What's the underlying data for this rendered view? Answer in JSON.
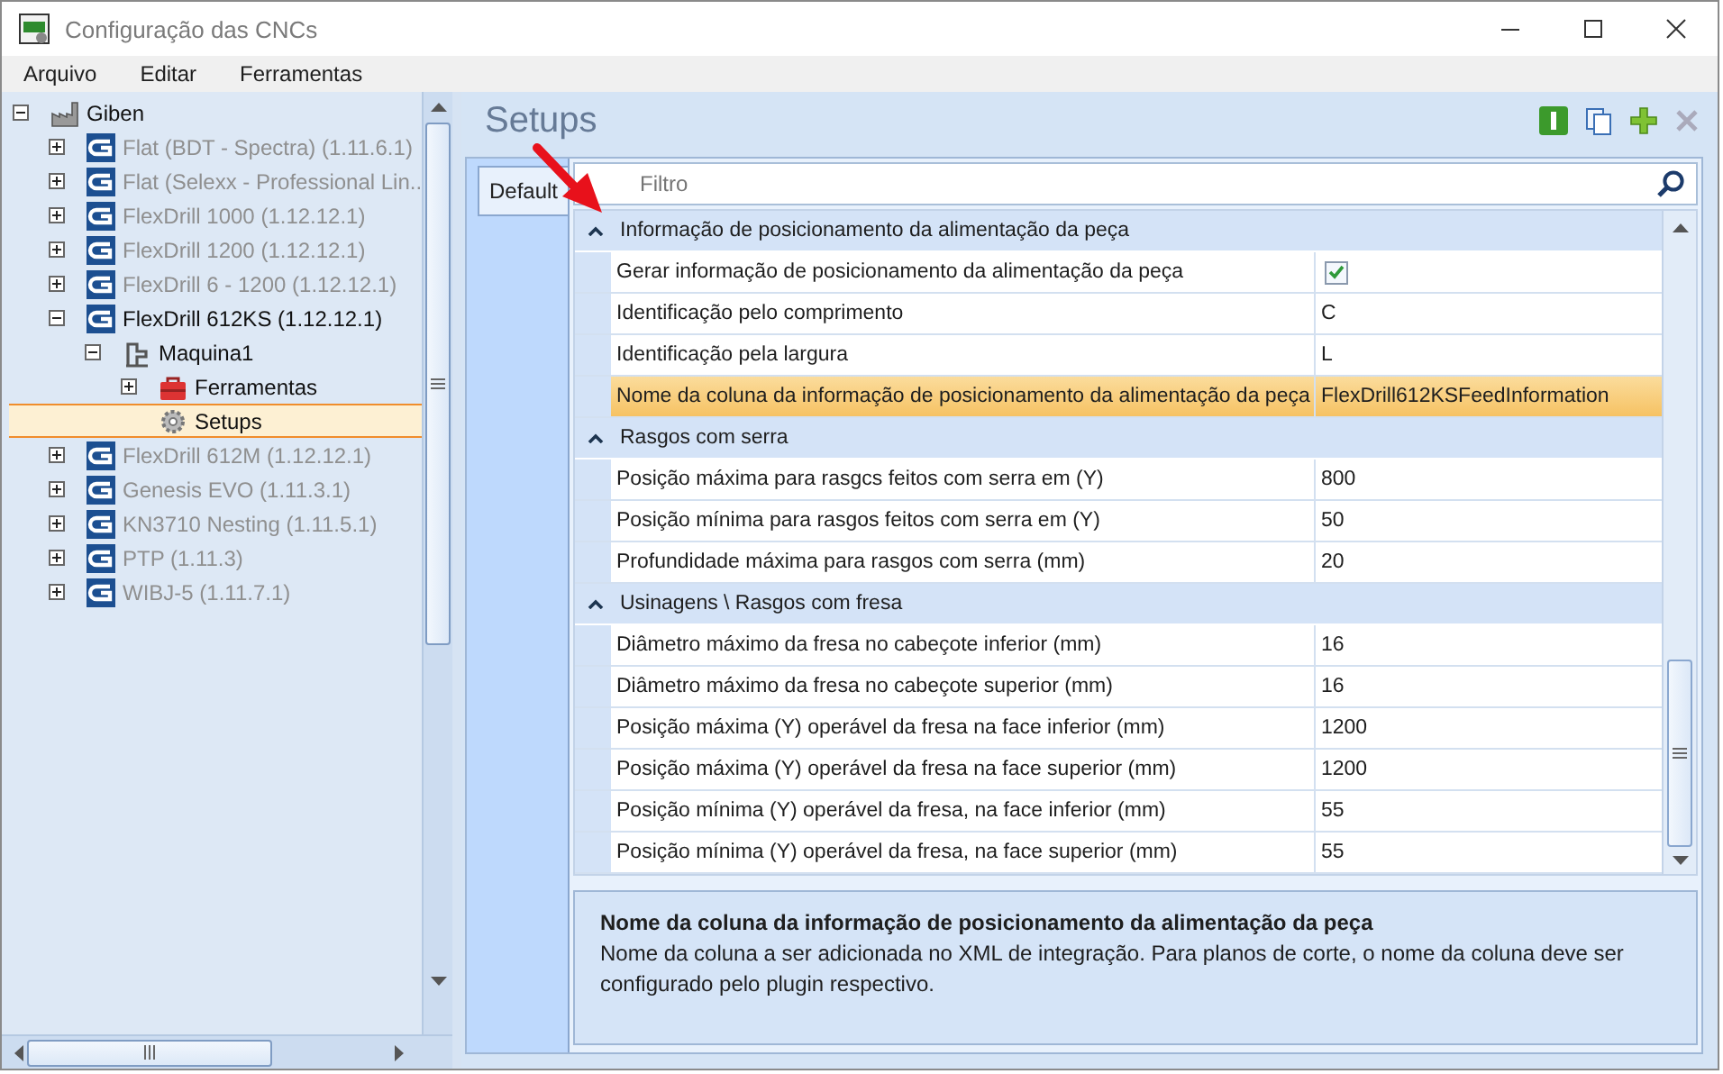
{
  "window": {
    "title": "Configuração das CNCs"
  },
  "menu": [
    "Arquivo",
    "Editar",
    "Ferramentas"
  ],
  "tree": [
    {
      "label": "Giben",
      "kind": "factory",
      "expanded": true,
      "selected": false,
      "dimmed": false,
      "children": [
        {
          "label": "Flat (BDT - Spectra) (1.11.6.1)",
          "kind": "machine-logo",
          "expanded": false,
          "selected": false,
          "dimmed": true
        },
        {
          "label": "Flat (Selexx - Professional Lin...",
          "kind": "machine-logo",
          "expanded": false,
          "selected": false,
          "dimmed": true
        },
        {
          "label": "FlexDrill 1000 (1.12.12.1)",
          "kind": "machine-logo",
          "expanded": false,
          "selected": false,
          "dimmed": true
        },
        {
          "label": "FlexDrill 1200 (1.12.12.1)",
          "kind": "machine-logo",
          "expanded": false,
          "selected": false,
          "dimmed": true
        },
        {
          "label": "FlexDrill 6 - 1200 (1.12.12.1)",
          "kind": "machine-logo",
          "expanded": false,
          "selected": false,
          "dimmed": true
        },
        {
          "label": "FlexDrill 612KS (1.12.12.1)",
          "kind": "machine-logo",
          "expanded": true,
          "selected": false,
          "dimmed": false,
          "children": [
            {
              "label": "Maquina1",
              "kind": "machine",
              "expanded": true,
              "selected": false,
              "dimmed": false,
              "children": [
                {
                  "label": "Ferramentas",
                  "kind": "toolbox",
                  "expanded": false,
                  "selected": false,
                  "dimmed": false
                },
                {
                  "label": "Setups",
                  "kind": "gear",
                  "selected": true,
                  "dimmed": false
                }
              ]
            }
          ]
        },
        {
          "label": "FlexDrill 612M (1.12.12.1)",
          "kind": "machine-logo",
          "expanded": false,
          "selected": false,
          "dimmed": true
        },
        {
          "label": "Genesis EVO (1.11.3.1)",
          "kind": "machine-logo",
          "expanded": false,
          "selected": false,
          "dimmed": true
        },
        {
          "label": "KN3710 Nesting (1.11.5.1)",
          "kind": "machine-logo",
          "expanded": false,
          "selected": false,
          "dimmed": true
        },
        {
          "label": "PTP (1.11.3)",
          "kind": "machine-logo",
          "expanded": false,
          "selected": false,
          "dimmed": true
        },
        {
          "label": "WIBJ-5 (1.11.7.1)",
          "kind": "machine-logo",
          "expanded": false,
          "selected": false,
          "dimmed": true
        }
      ]
    }
  ],
  "panel": {
    "title": "Setups",
    "tabs": [
      {
        "label": "Default",
        "selected": true
      }
    ],
    "search": {
      "placeholder": "Filtro"
    }
  },
  "categories": [
    {
      "title": "Informação de posicionamento da alimentação da peça",
      "expanded": true,
      "rows": [
        {
          "label": "Gerar informação de posicionamento da alimentação da peça",
          "kind": "checkbox",
          "checked": true,
          "selected": false
        },
        {
          "label": "Identificação pelo comprimento",
          "kind": "text",
          "value": "C",
          "selected": false
        },
        {
          "label": "Identificação pela largura",
          "kind": "text",
          "value": "L",
          "selected": false
        },
        {
          "label": "Nome da coluna da informação de posicionamento da alimentação da peça",
          "kind": "text",
          "value": "FlexDrill612KSFeedInformation",
          "selected": true
        }
      ]
    },
    {
      "title": "Rasgos com serra",
      "expanded": true,
      "rows": [
        {
          "label": "Posição máxima para rasgcs feitos com serra em (Y)",
          "kind": "text",
          "value": "800",
          "selected": false
        },
        {
          "label": "Posição mínima para rasgos feitos com serra em (Y)",
          "kind": "text",
          "value": "50",
          "selected": false
        },
        {
          "label": "Profundidade máxima para rasgos com serra (mm)",
          "kind": "text",
          "value": "20",
          "selected": false
        }
      ]
    },
    {
      "title": "Usinagens \\ Rasgos com fresa",
      "expanded": true,
      "rows": [
        {
          "label": "Diâmetro máximo da fresa no cabeçote inferior (mm)",
          "kind": "text",
          "value": "16",
          "selected": false
        },
        {
          "label": "Diâmetro máximo da fresa no cabeçote superior (mm)",
          "kind": "text",
          "value": "16",
          "selected": false
        },
        {
          "label": "Posição máxima (Y) operável da fresa na face inferior (mm)",
          "kind": "text",
          "value": "1200",
          "selected": false
        },
        {
          "label": "Posição máxima (Y) operável da fresa na face superior (mm)",
          "kind": "text",
          "value": "1200",
          "selected": false
        },
        {
          "label": "Posição mínima (Y) operável da fresa, na face inferior (mm)",
          "kind": "text",
          "value": "55",
          "selected": false
        },
        {
          "label": "Posição mínima (Y) operável da fresa, na face superior (mm)",
          "kind": "text",
          "value": "55",
          "selected": false
        }
      ]
    }
  ],
  "description": {
    "title": "Nome da coluna da informação de posicionamento da alimentação da peça",
    "text": "Nome da coluna a ser adicionada no XML de integração. Para planos de corte, o nome da coluna deve ser configurado pelo plugin respectivo."
  }
}
